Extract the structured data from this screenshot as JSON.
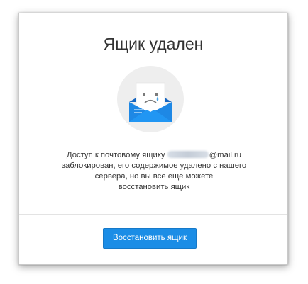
{
  "dialog": {
    "title": "Ящик удален",
    "message": {
      "part1": "Доступ к почтовому ящику ",
      "email_domain": "@mail.ru",
      "part2": "заблокирован, его содержимое удалено с нашего",
      "part3": "сервера, но вы все еще можете",
      "part4": "восстановить ящик"
    },
    "restore_button_label": "Восстановить ящик",
    "illustration_icon": "crying-envelope-icon"
  },
  "colors": {
    "accent": "#1b8de6",
    "envelope_blue": "#1e88e5",
    "circle_bg": "#eeeeee",
    "tear": "#4aa6e8"
  }
}
